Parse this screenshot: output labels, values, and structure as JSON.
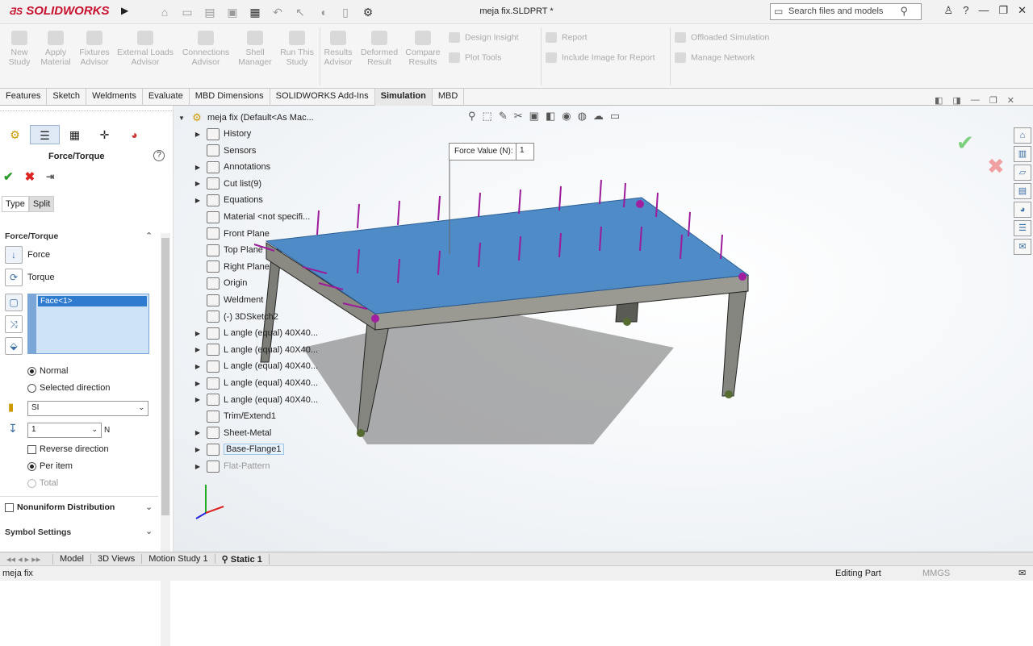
{
  "app": {
    "brand": "SOLIDWORKS",
    "doc_title": "meja fix.SLDPRT *"
  },
  "search": {
    "placeholder": "Search files and models"
  },
  "ribbon": {
    "buttons": [
      "New Study",
      "Apply Material",
      "Fixtures Advisor",
      "External Loads Advisor",
      "Connections Advisor",
      "Shell Manager",
      "Run This Study",
      "Results Advisor",
      "Deformed Result",
      "Compare Results"
    ],
    "small": [
      "Design Insight",
      "Plot Tools",
      "Report",
      "Include Image for Report",
      "Offloaded Simulation",
      "Manage Network"
    ]
  },
  "tabs": [
    "Features",
    "Sketch",
    "Weldments",
    "Evaluate",
    "MBD Dimensions",
    "SOLIDWORKS Add-Ins",
    "Simulation",
    "MBD"
  ],
  "active_tab": "Simulation",
  "pm": {
    "title": "Force/Torque",
    "type_tabs": [
      "Type",
      "Split"
    ],
    "section_force": "Force/Torque",
    "force_label": "Force",
    "torque_label": "Torque",
    "selection": "Face<1>",
    "normal": "Normal",
    "selected_direction": "Selected direction",
    "unit_system": "SI",
    "force_value": "1",
    "unit": "N",
    "reverse": "Reverse direction",
    "per_item": "Per item",
    "total": "Total",
    "nonuniform": "Nonuniform Distribution",
    "symbol": "Symbol Settings"
  },
  "tree": {
    "root": "meja fix  (Default<As Mac...",
    "items": [
      {
        "label": "History",
        "icon": "history-icon",
        "exp": true
      },
      {
        "label": "Sensors",
        "icon": "sensor-icon",
        "exp": false
      },
      {
        "label": "Annotations",
        "icon": "annotation-icon",
        "exp": true
      },
      {
        "label": "Cut list(9)",
        "icon": "cutlist-icon",
        "exp": true
      },
      {
        "label": "Equations",
        "icon": "equation-icon",
        "exp": true
      },
      {
        "label": "Material <not specifi...",
        "icon": "material-icon",
        "exp": false
      },
      {
        "label": "Front Plane",
        "icon": "plane-icon",
        "exp": false
      },
      {
        "label": "Top Plane",
        "icon": "plane-icon",
        "exp": false
      },
      {
        "label": "Right Plane",
        "icon": "plane-icon",
        "exp": false
      },
      {
        "label": "Origin",
        "icon": "origin-icon",
        "exp": false
      },
      {
        "label": "Weldment",
        "icon": "weldment-icon",
        "exp": false
      },
      {
        "label": "(-) 3DSketch2",
        "icon": "3dsketch-icon",
        "exp": false
      },
      {
        "label": "L angle (equal) 40X40...",
        "icon": "structure-icon",
        "exp": true
      },
      {
        "label": "L angle (equal) 40X40...",
        "icon": "structure-icon",
        "exp": true
      },
      {
        "label": "L angle (equal) 40X40...",
        "icon": "structure-icon",
        "exp": true
      },
      {
        "label": "L angle (equal) 40X40...",
        "icon": "structure-icon",
        "exp": true
      },
      {
        "label": "L angle (equal) 40X40...",
        "icon": "structure-icon",
        "exp": true
      },
      {
        "label": "Trim/Extend1",
        "icon": "trim-icon",
        "exp": false
      },
      {
        "label": "Sheet-Metal",
        "icon": "sheetmetal-icon",
        "exp": true
      },
      {
        "label": "Base-Flange1",
        "icon": "flange-icon",
        "exp": true
      },
      {
        "label": "Flat-Pattern",
        "icon": "flatpattern-icon",
        "exp": true
      }
    ]
  },
  "callout": {
    "label": "Force Value (N):",
    "value": "1"
  },
  "bottom_tabs": [
    "Model",
    "3D Views",
    "Motion Study 1",
    "Static 1"
  ],
  "status": {
    "left": "meja fix",
    "mode": "Editing Part",
    "units": "MMGS"
  }
}
